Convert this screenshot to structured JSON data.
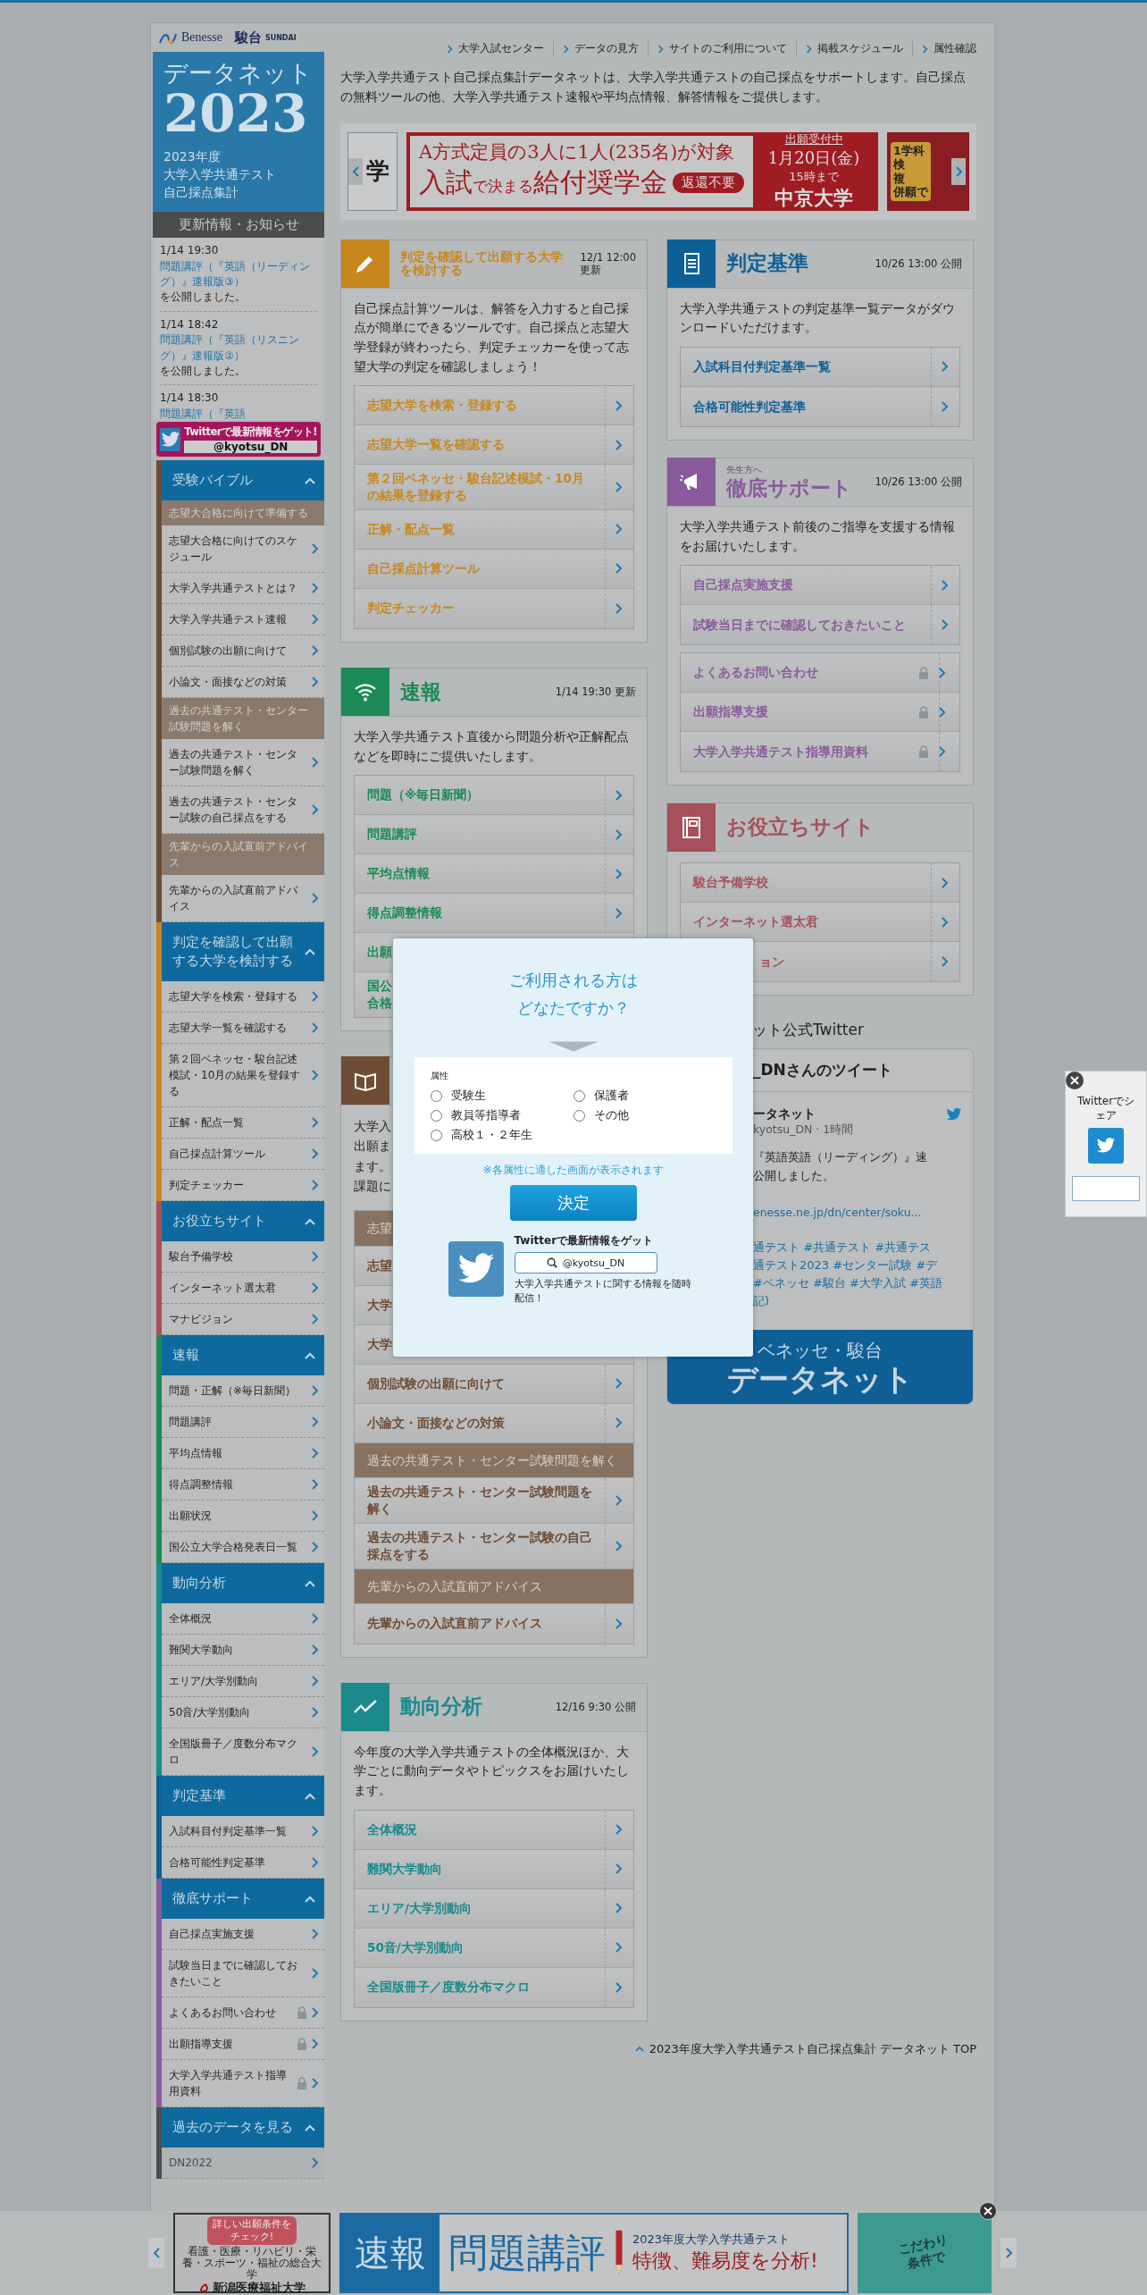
{
  "nav": [
    "大学入試センター",
    "データの見方",
    "サイトのご利用について",
    "掲載スケジュール",
    "属性確認"
  ],
  "brand": {
    "benesse": "Benesse",
    "sundai": "駿台",
    "sundai_en": "SUNDAI",
    "title": "データネット",
    "year": "2023",
    "subtitle": [
      "2023年度",
      "大学入学共通テスト",
      "自己採点集計"
    ]
  },
  "news": {
    "title": "更新情報・お知らせ",
    "items": [
      {
        "time": "1/14 19:30",
        "link": "問題講評（『英語（リーディング）』速報版③）",
        "rest": "を公開しました。"
      },
      {
        "time": "1/14 18:42",
        "link": "問題講評（『英語（リスニング）』速報版②）",
        "rest": "を公開しました。"
      },
      {
        "time": "1/14 18:30",
        "link": "問題講評（『英語"
      }
    ]
  },
  "twitter_banner": {
    "text": "Twitterで最新情報をゲット!",
    "handle": "@kyotsu_DN"
  },
  "sidebar": [
    {
      "title": "受験バイブル",
      "color": "#6e4c35",
      "expanded": true,
      "items": [
        {
          "kind": "sub",
          "label": "志望大合格に向けて準備する"
        },
        {
          "kind": "link",
          "label": "志望大合格に向けてのスケジュール"
        },
        {
          "kind": "link",
          "label": "大学入学共通テストとは？"
        },
        {
          "kind": "link",
          "label": "大学入学共通テスト速報"
        },
        {
          "kind": "link",
          "label": "個別試験の出願に向けて"
        },
        {
          "kind": "link",
          "label": "小論文・面接などの対策"
        },
        {
          "kind": "sub",
          "label": "過去の共通テスト・センター試験問題を解く"
        },
        {
          "kind": "link",
          "label": "過去の共通テスト・センター試験問題を解く"
        },
        {
          "kind": "link",
          "label": "過去の共通テスト・センター試験の自己採点をする"
        },
        {
          "kind": "sub",
          "label": "先輩からの入試直前アドバイス"
        },
        {
          "kind": "link",
          "label": "先輩からの入試直前アドバイス"
        }
      ]
    },
    {
      "title": "判定を確認して出願する大学を検討する",
      "color": "#c8871e",
      "expanded": true,
      "items": [
        {
          "kind": "link",
          "label": "志望大学を検索・登録する"
        },
        {
          "kind": "link",
          "label": "志望大学一覧を確認する"
        },
        {
          "kind": "link",
          "label": "第２回ベネッセ・駿台記述模試・10月の結果を登録する"
        },
        {
          "kind": "link",
          "label": "正解・配点一覧"
        },
        {
          "kind": "link",
          "label": "自己採点計算ツール"
        },
        {
          "kind": "link",
          "label": "判定チェッカー"
        }
      ]
    },
    {
      "title": "お役立ちサイト",
      "color": "#a5505a",
      "expanded": true,
      "items": [
        {
          "kind": "link",
          "label": "駿台予備学校"
        },
        {
          "kind": "link",
          "label": "インターネット選太君"
        },
        {
          "kind": "link",
          "label": "マナビジョン"
        }
      ]
    },
    {
      "title": "速報",
      "color": "#1b8a55",
      "expanded": true,
      "items": [
        {
          "kind": "link",
          "label": "問題・正解（※毎日新聞）"
        },
        {
          "kind": "link",
          "label": "問題講評"
        },
        {
          "kind": "link",
          "label": "平均点情報"
        },
        {
          "kind": "link",
          "label": "得点調整情報"
        },
        {
          "kind": "link",
          "label": "出願状況"
        },
        {
          "kind": "link",
          "label": "国公立大学合格発表日一覧"
        }
      ]
    },
    {
      "title": "動向分析",
      "color": "#1a8a8c",
      "expanded": true,
      "items": [
        {
          "kind": "link",
          "label": "全体概況"
        },
        {
          "kind": "link",
          "label": "難関大学動向"
        },
        {
          "kind": "link",
          "label": "エリア/大学別動向"
        },
        {
          "kind": "link",
          "label": "50音/大学別動向"
        },
        {
          "kind": "link",
          "label": "全国版冊子／度数分布マクロ"
        }
      ]
    },
    {
      "title": "判定基準",
      "color": "#0e5f96",
      "expanded": true,
      "items": [
        {
          "kind": "link",
          "label": "入試科目付判定基準一覧"
        },
        {
          "kind": "link",
          "label": "合格可能性判定基準"
        }
      ]
    },
    {
      "title": "徹底サポート",
      "color": "#8a5b9c",
      "expanded": true,
      "items": [
        {
          "kind": "link",
          "label": "自己採点実施支援",
          "locked": false
        },
        {
          "kind": "link",
          "label": "試験当日までに確認しておきたいこと",
          "locked": false
        },
        {
          "kind": "link",
          "label": "よくあるお問い合わせ",
          "locked": true
        },
        {
          "kind": "link",
          "label": "出願指導支援",
          "locked": true
        },
        {
          "kind": "link",
          "label": "大学入学共通テスト指導用資料",
          "locked": true
        }
      ]
    },
    {
      "title": "過去のデータを見る",
      "color": "#4a4d50",
      "expanded": true,
      "items": [
        {
          "kind": "faded",
          "label": "DN2022"
        }
      ]
    }
  ],
  "intro": "大学入学共通テスト自己採点集計データネットは、大学入学共通テストの自己採点をサポートします。自己採点の無料ツールの他、大学入学共通テスト速報や平均点情報、解答情報をご提供します。",
  "banner": {
    "left_text": "学",
    "headline": "A方式定員の3人に1人(235名)が対象",
    "title_parts": [
      {
        "kind": "big",
        "text": "入試"
      },
      {
        "kind": "small",
        "text": "で決まる"
      },
      {
        "kind": "big",
        "text": "給付奨学金"
      }
    ],
    "badge": "返還不要",
    "status": "出願受付中",
    "deadline": "1月20日(金)",
    "time": "15時まで",
    "school": "中京大学",
    "right_texts": [
      "1学科",
      "検",
      "複",
      "併願で"
    ]
  },
  "columns": {
    "left": [
      {
        "kind": "check",
        "color": "#c8871e",
        "title": "判定を確認して出願する大学を検討する",
        "date": "12/1 12:00\n更新",
        "desc": "自己採点計算ツールは、解答を入力すると自己採点が簡単にできるツールです。自己採点と志望大学登録が終わったら、判定チェッカーを使って志望大学の判定を確認しましょう！",
        "groups": [
          [
            {
              "kind": "link",
              "label": "志望大学を検索・登録する"
            },
            {
              "kind": "link",
              "label": "志望大学一覧を確認する"
            },
            {
              "kind": "link",
              "label": "第２回ベネッセ・駿台記述模試・10月の結果を登録する"
            },
            {
              "kind": "link",
              "label": "正解・配点一覧"
            },
            {
              "kind": "link",
              "label": "自己採点計算ツール"
            },
            {
              "kind": "link",
              "label": "判定チェッカー"
            }
          ]
        ]
      },
      {
        "kind": "news",
        "color": "#1b8a55",
        "title": "速報",
        "date": "1/14 19:30 更新",
        "desc": "大学入学共通テスト直後から問題分析や正解配点などを即時にご提供いたします。",
        "groups": [
          [
            {
              "kind": "link",
              "label": "問題（※毎日新聞）"
            },
            {
              "kind": "link",
              "label": "問題講評"
            },
            {
              "kind": "link",
              "label": "平均点情報"
            },
            {
              "kind": "link",
              "label": "得点調整情報"
            },
            {
              "kind": "cut-left",
              "label": "出願"
            },
            {
              "kind": "cut-left",
              "label": "国公合格"
            }
          ]
        ]
      },
      {
        "kind": "bible",
        "color": "#6e4c35",
        "desc": "大学入出願まます。課題に",
        "groups": [
          [
            {
              "kind": "section",
              "label": "志望"
            },
            {
              "kind": "cut-left",
              "label": "志望"
            },
            {
              "kind": "cut-left",
              "label": "大学"
            },
            {
              "kind": "cut-left",
              "label": "大学"
            },
            {
              "kind": "link",
              "label": "個別試験の出願に向けて"
            },
            {
              "kind": "link",
              "label": "小論文・面接などの対策"
            },
            {
              "kind": "section",
              "label": "過去の共通テスト・センター試験問題を解く"
            },
            {
              "kind": "link",
              "label": "過去の共通テスト・センター試験問題を解く"
            },
            {
              "kind": "link",
              "label": "過去の共通テスト・センター試験の自己採点をする"
            },
            {
              "kind": "section",
              "label": "先輩からの入試直前アドバイス"
            },
            {
              "kind": "link",
              "label": "先輩からの入試直前アドバイス"
            }
          ]
        ]
      },
      {
        "kind": "trend",
        "color": "#1a8a8c",
        "title": "動向分析",
        "date": "12/16 9:30 公開",
        "desc": "今年度の大学入学共通テストの全体概況ほか、大学ごとに動向データやトピックスをお届けいたします。",
        "groups": [
          [
            {
              "kind": "link",
              "label": "全体概況"
            },
            {
              "kind": "link",
              "label": "難関大学動向"
            },
            {
              "kind": "link",
              "label": "エリア/大学別動向"
            },
            {
              "kind": "link",
              "label": "50音/大学別動向"
            },
            {
              "kind": "link",
              "label": "全国版冊子／度数分布マクロ"
            }
          ]
        ]
      }
    ],
    "right": [
      {
        "kind": "criteria",
        "color": "#0e5f96",
        "title": "判定基準",
        "date": "10/26 13:00 公開",
        "desc": "大学入学共通テストの判定基準一覧データがダウンロードいただけます。",
        "groups": [
          [
            {
              "kind": "link",
              "label": "入試科目付判定基準一覧"
            },
            {
              "kind": "link",
              "label": "合格可能性判定基準"
            }
          ]
        ]
      },
      {
        "kind": "support",
        "color": "#8a5b9c",
        "eyebrow": "先生方へ",
        "title": "徹底サポート",
        "date": "10/26 13:00 公開",
        "desc": "大学入学共通テスト前後のご指導を支援する情報をお届けいたします。",
        "groups": [
          [
            {
              "kind": "link",
              "label": "自己採点実施支援",
              "locked": false
            },
            {
              "kind": "link",
              "label": "試験当日までに確認しておきたいこと",
              "locked": false
            }
          ],
          [
            {
              "kind": "link",
              "label": "よくあるお問い合わせ",
              "locked": true
            },
            {
              "kind": "link",
              "label": "出願指導支援",
              "locked": true
            },
            {
              "kind": "link",
              "label": "大学入学共通テスト指導用資料",
              "locked": true
            }
          ]
        ]
      },
      {
        "kind": "links",
        "color": "#a5505a",
        "title": "お役立ちサイト",
        "groups": [
          [
            {
              "kind": "link",
              "label": "駿台予備学校"
            },
            {
              "kind": "link",
              "label": "インターネット選太君"
            },
            {
              "kind": "cut-right",
              "label": "ョン"
            }
          ]
        ]
      }
    ]
  },
  "twitter": {
    "heading": "ット公式Twitter",
    "card_title": "_DNさんのツイート",
    "author": "ータネット",
    "handle": "kyotsu_DN · 1時間",
    "text": [
      "『英語英語（リーディング）』速",
      "公開しました。"
    ],
    "link": "enesse.ne.jp/dn/center/soku...",
    "tags": [
      "通テスト #共通テスト #共通テス",
      "通テスト2023 #センター試験 #デ",
      "#ベネッセ #駿台 #大学入試 #英語",
      "記)"
    ],
    "banner_top": "ベネッセ・駿台",
    "banner_main": "データネット"
  },
  "top_link": "2023年度大学入学共通テスト自己採点集計 データネット TOP",
  "modal": {
    "title": "ご利用される方はどなたですか？",
    "field_label": "属性",
    "options": [
      {
        "label": "受験生",
        "selected": false
      },
      {
        "label": "保護者",
        "selected": false
      },
      {
        "label": "教員等指導者",
        "selected": false
      },
      {
        "label": "その他",
        "selected": false
      },
      {
        "label": "高校１・２年生",
        "selected": false
      }
    ],
    "note": "※各属性に適した画面が表示されます",
    "button": "決定",
    "twitter_title": "Twitterで最新情報をゲット",
    "twitter_handle": "@kyotsu_DN",
    "twitter_text": "大学入学共通テストに関する情報を随時配信！"
  },
  "share": {
    "text": "Twitterでシェア"
  },
  "ads": [
    {
      "kind": "school",
      "button": "詳しい出願条件をチェック!",
      "tagline": "看護・医療・リハビリ・栄養・スポーツ・福祉の総合大学",
      "name": "新潟医療福祉大学"
    },
    {
      "kind": "review",
      "label_a": "速報",
      "label_b": "問題講評",
      "top": "2023年度大学入学共通テスト",
      "bottom": "特徴、難易度を分析!"
    },
    {
      "kind": "search",
      "text": "こだわり条件で"
    }
  ]
}
